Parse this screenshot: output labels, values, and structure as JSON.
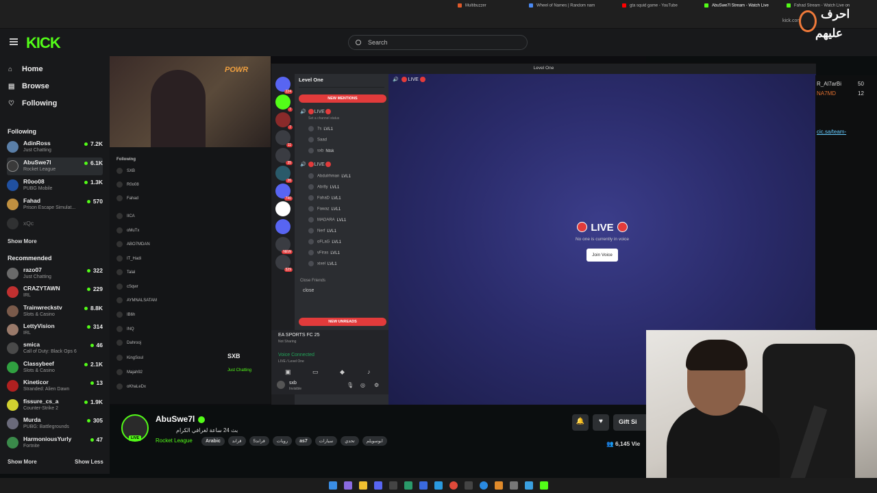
{
  "browser": {
    "tabs": [
      {
        "label": "Multibuzzer",
        "color": "#e05a2a"
      },
      {
        "label": "Wheel of Names | Random nam",
        "color": "#4a8af4"
      },
      {
        "label": "gta squid game - YouTube",
        "color": "#ff0000"
      },
      {
        "label": "AbuSwe7l Stream - Watch Live",
        "color": "#53fc18"
      },
      {
        "label": "Fahad Stream - Watch Live on",
        "color": "#53fc18"
      }
    ],
    "address": "kick.com"
  },
  "header": {
    "logo": "KICK",
    "search_placeholder": "Search"
  },
  "sidebar": {
    "nav": [
      {
        "label": "Home",
        "icon": "home-icon"
      },
      {
        "label": "Browse",
        "icon": "browse-icon"
      },
      {
        "label": "Following",
        "icon": "heart-icon"
      }
    ],
    "following_title": "Following",
    "following": [
      {
        "name": "AdinRoss",
        "category": "Just Chatting",
        "viewers": "7.2K",
        "color": "#5a7fa8"
      },
      {
        "name": "AbuSwe7l",
        "category": "Rocket League",
        "viewers": "6.1K",
        "color": "#3a3a3a"
      },
      {
        "name": "R0oo08",
        "category": "PUBG Mobile",
        "viewers": "1.3K",
        "color": "#2050a0"
      },
      {
        "name": "Fahad",
        "category": "Prison Escape Simulat...",
        "viewers": "570",
        "color": "#c09040"
      },
      {
        "name": "xQc",
        "category": "",
        "viewers": "",
        "color": "#555555"
      }
    ],
    "show_more": "Show More",
    "recommended_title": "Recommended",
    "recommended": [
      {
        "name": "razo07",
        "category": "Just Chatting",
        "viewers": "322",
        "color": "#6a6a6a"
      },
      {
        "name": "CRAZYTAWN",
        "category": "IRL",
        "viewers": "229",
        "color": "#c03030"
      },
      {
        "name": "Trainwreckstv",
        "category": "Slots & Casino",
        "viewers": "8.8K",
        "color": "#7a5a4a"
      },
      {
        "name": "LettyVision",
        "category": "IRL",
        "viewers": "314",
        "color": "#9a7a6a"
      },
      {
        "name": "smica",
        "category": "Call of Duty: Black Ops 6",
        "viewers": "46",
        "color": "#4a4a4a"
      },
      {
        "name": "Classybeef",
        "category": "Slots & Casino",
        "viewers": "2.1K",
        "color": "#30a040"
      },
      {
        "name": "Kineticor",
        "category": "Stranded: Alien Dawn",
        "viewers": "13",
        "color": "#b02020"
      },
      {
        "name": "fissure_cs_a",
        "category": "Counter-Strike 2",
        "viewers": "1.9K",
        "color": "#d0d030"
      },
      {
        "name": "Murda",
        "category": "PUBG: Battlegrounds",
        "viewers": "305",
        "color": "#6a6a7a"
      },
      {
        "name": "HarmoniousYurly",
        "category": "Fortnite",
        "viewers": "47",
        "color": "#3a8a4a"
      }
    ],
    "show_more_2": "Show More",
    "show_less": "Show Less"
  },
  "nested_following": {
    "title": "Following",
    "items": [
      "SXB",
      "R0o08",
      "Fahad",
      "IICA",
      "oMuTx",
      "ABO7MDAN",
      "IT_Hadi",
      "Talal",
      "cSqwr",
      "AYMNALSATAM",
      "IB6h",
      "INQ",
      "Dahrooj",
      "KingSoul",
      "Majah92",
      "oKhaLeDx"
    ],
    "sxb_label": "SXB",
    "sxb_category": "Just Chatting"
  },
  "discord": {
    "window_title": "Level One",
    "server_name": "Level One",
    "new_mentions": "NEW MENTIONS",
    "vc1": "LIVE",
    "vc1_status": "Set a channel status",
    "vc1_users": [
      {
        "name": "7s",
        "tag": "LVL1"
      },
      {
        "name": "Saad",
        "tag": ""
      },
      {
        "name": "sxb",
        "tag": "Ntsk"
      }
    ],
    "vc2": "LIVE",
    "vc2_users": [
      {
        "name": "Abdulrhman",
        "tag": "LVL1"
      },
      {
        "name": "Abr8y",
        "tag": "LVL1"
      },
      {
        "name": "FahaD",
        "tag": "LVL1"
      },
      {
        "name": "Fawaz",
        "tag": "LVL1"
      },
      {
        "name": "MADARA",
        "tag": "LVL1"
      },
      {
        "name": "Nerf",
        "tag": "LVL1"
      },
      {
        "name": "oFLaG",
        "tag": "LVL1"
      },
      {
        "name": "vFiras",
        "tag": "LVL1"
      },
      {
        "name": "xixel",
        "tag": "LVL1"
      }
    ],
    "category": "Close Friends",
    "close_channel": "close",
    "new_unreads": "NEW UNREADS",
    "activity": "EA SPORTS FC 25",
    "activity_sub": "Not Sharing",
    "voice_connected": "Voice Connected",
    "voice_sub": "LIVE / Level One",
    "user": "sxb",
    "user_status": "Invisible",
    "stage_top": "LIVE",
    "stage_title": "LIVE",
    "stage_sub": "No one is currently in voice",
    "join_voice": "Join Voice",
    "guild_badges": [
      "224",
      "7",
      "7",
      "11",
      "35",
      "26",
      "740",
      "NEW",
      "529"
    ]
  },
  "chat_peek": {
    "user1": "R_Al7arBi",
    "count1": "50",
    "user2": "NA7MD",
    "count2": "12",
    "link": "cic.sa/team-"
  },
  "stream": {
    "name": "AbuSwe7l",
    "live": "LIVE",
    "title": "بث 24 ساعة لغرافي الكرام",
    "category": "Rocket League",
    "tags": [
      "Arabic",
      "قراند",
      "قراند5",
      "رويات",
      "as7",
      "سيارات",
      "تحدي",
      "ابوسويلم"
    ],
    "gift": "Gift Si",
    "viewers": "6,145 Vie"
  },
  "watermark": {
    "line1": "احرف",
    "line2": "عليهم"
  }
}
